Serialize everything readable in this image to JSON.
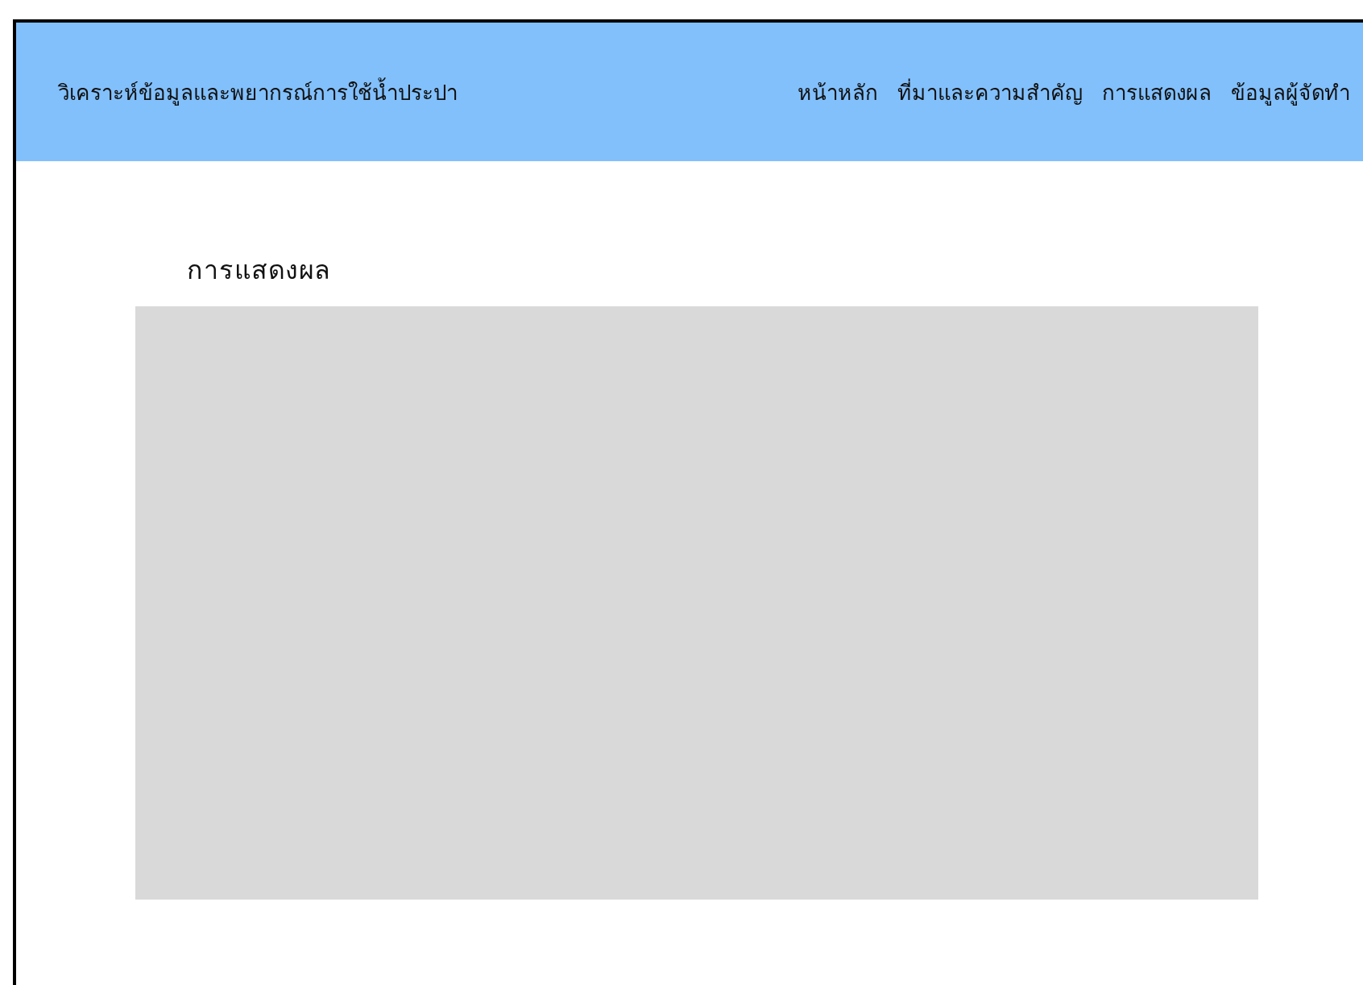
{
  "header": {
    "title": "วิเคราะห์ข้อมูลและพยากรณ์การใช้น้ำประปา",
    "nav": [
      {
        "label": "หน้าหลัก"
      },
      {
        "label": "ที่มาและความสำคัญ"
      },
      {
        "label": "การแสดงผล"
      },
      {
        "label": "ข้อมูลผู้จัดทำ"
      }
    ]
  },
  "section": {
    "title": "การแสดงผล"
  }
}
